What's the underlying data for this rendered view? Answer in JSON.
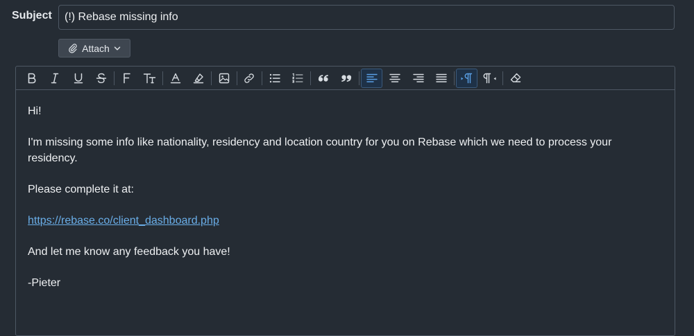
{
  "subject": {
    "label": "Subject",
    "value": "(!) Rebase missing info"
  },
  "attach": {
    "label": "Attach",
    "icon": "paperclip-icon",
    "dropdown_icon": "chevron-down-icon"
  },
  "toolbar": {
    "buttons": [
      {
        "name": "bold",
        "icon": "bold-icon"
      },
      {
        "name": "italic",
        "icon": "italic-icon"
      },
      {
        "name": "underline",
        "icon": "underline-icon"
      },
      {
        "name": "strikethrough",
        "icon": "strikethrough-icon"
      },
      {
        "name": "font-family",
        "icon": "font-family-icon"
      },
      {
        "name": "font-size",
        "icon": "font-size-icon"
      },
      {
        "name": "text-color",
        "icon": "text-color-icon"
      },
      {
        "name": "highlight",
        "icon": "highlighter-icon"
      },
      {
        "name": "insert-image",
        "icon": "image-icon"
      },
      {
        "name": "insert-link",
        "icon": "link-icon"
      },
      {
        "name": "bullet-list",
        "icon": "bullet-list-icon"
      },
      {
        "name": "numbered-list",
        "icon": "numbered-list-icon"
      },
      {
        "name": "blockquote-open",
        "icon": "quote-open-icon"
      },
      {
        "name": "blockquote-close",
        "icon": "quote-close-icon"
      },
      {
        "name": "align-left",
        "icon": "align-left-icon",
        "active": true
      },
      {
        "name": "align-center",
        "icon": "align-center-icon"
      },
      {
        "name": "align-right",
        "icon": "align-right-icon"
      },
      {
        "name": "justify",
        "icon": "align-justify-icon"
      },
      {
        "name": "ltr",
        "icon": "ltr-icon",
        "active": true
      },
      {
        "name": "rtl",
        "icon": "rtl-icon"
      },
      {
        "name": "clear-formatting",
        "icon": "eraser-icon"
      }
    ]
  },
  "body": {
    "greeting": "Hi!",
    "paragraph1": "I'm missing some info like nationality, residency and location country for you on Rebase which we need to process your residency.",
    "paragraph2": "Please complete it at:",
    "link_text": "https://rebase.co/client_dashboard.php",
    "paragraph3": "And let me know any feedback you have!",
    "signature": "-Pieter"
  },
  "colors": {
    "background": "#252c34",
    "border": "#4e5864",
    "link": "#6aaee8",
    "active_accent": "#5aa0e6"
  }
}
